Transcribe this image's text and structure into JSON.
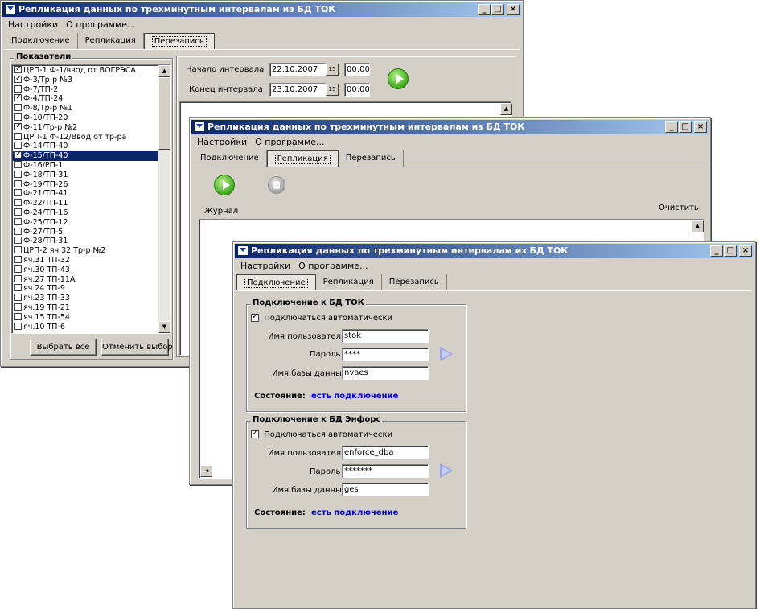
{
  "window_title": "Репликация данных по трехминутным интервалам из БД ТОК",
  "menu": {
    "settings": "Настройки",
    "about": "О программе..."
  },
  "tabs": {
    "connect": "Подключение",
    "replicate": "Репликация",
    "rewrite": "Перезапись"
  },
  "win1": {
    "indicators_title": "Показатели",
    "items": [
      {
        "label": "ЦРП-1 Ф-1/ввод от ВОГРЭСА",
        "checked": true,
        "selected": false
      },
      {
        "label": "Ф-3/Тр-р №3",
        "checked": true,
        "selected": false
      },
      {
        "label": "Ф-7/ТП-2",
        "checked": false,
        "selected": false
      },
      {
        "label": "Ф-4/ТП-24",
        "checked": true,
        "selected": false
      },
      {
        "label": "Ф-8/Тр-р №1",
        "checked": false,
        "selected": false
      },
      {
        "label": "Ф-10/ТП-20",
        "checked": false,
        "selected": false
      },
      {
        "label": "Ф-11/Тр-р №2",
        "checked": true,
        "selected": false
      },
      {
        "label": "ЦРП-1 Ф-12/Ввод от тр-ра",
        "checked": false,
        "selected": false
      },
      {
        "label": "Ф-14/ТП-40",
        "checked": false,
        "selected": false
      },
      {
        "label": "Ф-15/ТП-40",
        "checked": true,
        "selected": true
      },
      {
        "label": "Ф-16/РП-1",
        "checked": false,
        "selected": false
      },
      {
        "label": "Ф-18/ТП-31",
        "checked": false,
        "selected": false
      },
      {
        "label": "Ф-19/ТП-26",
        "checked": false,
        "selected": false
      },
      {
        "label": "Ф-21/ТП-41",
        "checked": false,
        "selected": false
      },
      {
        "label": "Ф-22/ТП-11",
        "checked": false,
        "selected": false
      },
      {
        "label": "Ф-24/ТП-16",
        "checked": false,
        "selected": false
      },
      {
        "label": "Ф-25/ТП-12",
        "checked": false,
        "selected": false
      },
      {
        "label": "Ф-27/ТП-5",
        "checked": false,
        "selected": false
      },
      {
        "label": "Ф-28/ТП-31",
        "checked": false,
        "selected": false
      },
      {
        "label": "ЦРП-2  яч.32 Тр-р №2",
        "checked": false,
        "selected": false
      },
      {
        "label": "яч.31 ТП-32",
        "checked": false,
        "selected": false
      },
      {
        "label": "яч.30 ТП-43",
        "checked": false,
        "selected": false
      },
      {
        "label": "яч.27 ТП-11А",
        "checked": false,
        "selected": false
      },
      {
        "label": "яч.24 ТП-9",
        "checked": false,
        "selected": false
      },
      {
        "label": "яч.23 ТП-33",
        "checked": false,
        "selected": false
      },
      {
        "label": "яч.19 ТП-21",
        "checked": false,
        "selected": false
      },
      {
        "label": "яч.15 ТП-54",
        "checked": false,
        "selected": false
      },
      {
        "label": "яч.10 ТП-6",
        "checked": false,
        "selected": false
      }
    ],
    "select_all": "Выбрать все",
    "deselect": "Отменить выбор",
    "start_label": "Начало интервала",
    "start_date": "22.10.2007",
    "start_time": "00:00",
    "end_label": "Конец интервала",
    "end_date": "23.10.2007",
    "end_time": "00:00",
    "cal_glyph": "15"
  },
  "win2": {
    "journal": "Журнал",
    "clear": "Очистить"
  },
  "win3": {
    "group1": {
      "title": "Подключение к БД ТОК",
      "auto": "Подключаться автоматически",
      "user_label": "Имя пользователя",
      "user_value": "stok",
      "pass_label": "Пароль",
      "pass_value": "****",
      "db_label": "Имя базы данных",
      "db_value": "nvaes",
      "state_label": "Состояние:",
      "state_value": "есть подключение"
    },
    "group2": {
      "title": "Подключение к БД Энфорс",
      "auto": "Подключаться автоматически",
      "user_label": "Имя пользователя",
      "user_value": "enforce_dba",
      "pass_label": "Пароль",
      "pass_value": "*******",
      "db_label": "Имя базы данных",
      "db_value": "ges",
      "state_label": "Состояние:",
      "state_value": "есть подключение"
    }
  },
  "colors": {
    "title_start": "#0a246a",
    "title_end": "#a6caf0",
    "status": "#0000cc",
    "face": "#d4d0c8"
  }
}
